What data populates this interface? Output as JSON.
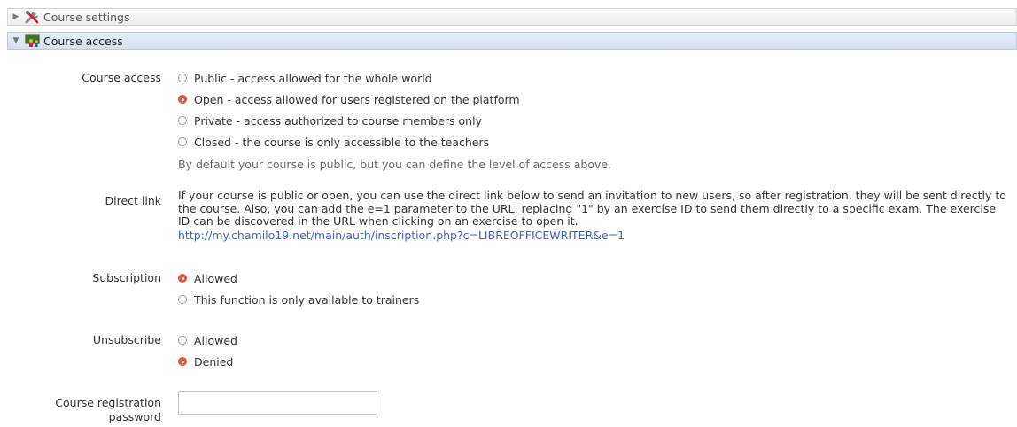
{
  "panels": {
    "settings": {
      "title": "Course settings",
      "icon": "tools-icon"
    },
    "access": {
      "title": "Course access",
      "icon": "classroom-icon"
    }
  },
  "course_access": {
    "label": "Course access",
    "options": [
      {
        "label": "Public - access allowed for the whole world",
        "checked": false
      },
      {
        "label": "Open - access allowed for users registered on the platform",
        "checked": true
      },
      {
        "label": "Private - access authorized to course members only",
        "checked": false
      },
      {
        "label": "Closed - the course is only accessible to the teachers",
        "checked": false
      }
    ],
    "help": "By default your course is public, but you can define the level of access above."
  },
  "direct_link": {
    "label": "Direct link",
    "text": "If your course is public or open, you can use the direct link below to send an invitation to new users, so after registration, they will be sent directly to the course. Also, you can add the e=1 parameter to the URL, replacing \"1\" by an exercise ID to send them directly to a specific exam. The exercise ID can be discovered in the URL when clicking on an exercise to open it.",
    "url": "http://my.chamilo19.net/main/auth/inscription.php?c=LIBREOFFICEWRITER&e=1"
  },
  "subscription": {
    "label": "Subscription",
    "options": [
      {
        "label": "Allowed",
        "checked": true
      },
      {
        "label": "This function is only available to trainers",
        "checked": false
      }
    ]
  },
  "unsubscribe": {
    "label": "Unsubscribe",
    "options": [
      {
        "label": "Allowed",
        "checked": false
      },
      {
        "label": "Denied",
        "checked": true
      }
    ]
  },
  "registration_password": {
    "label_line1": "Course registration",
    "label_line2": "password",
    "value": "",
    "placeholder": ""
  },
  "colors": {
    "radio_checked": "#e4583c",
    "link": "#3a63c8",
    "header_bg": "#d4e1f1"
  }
}
